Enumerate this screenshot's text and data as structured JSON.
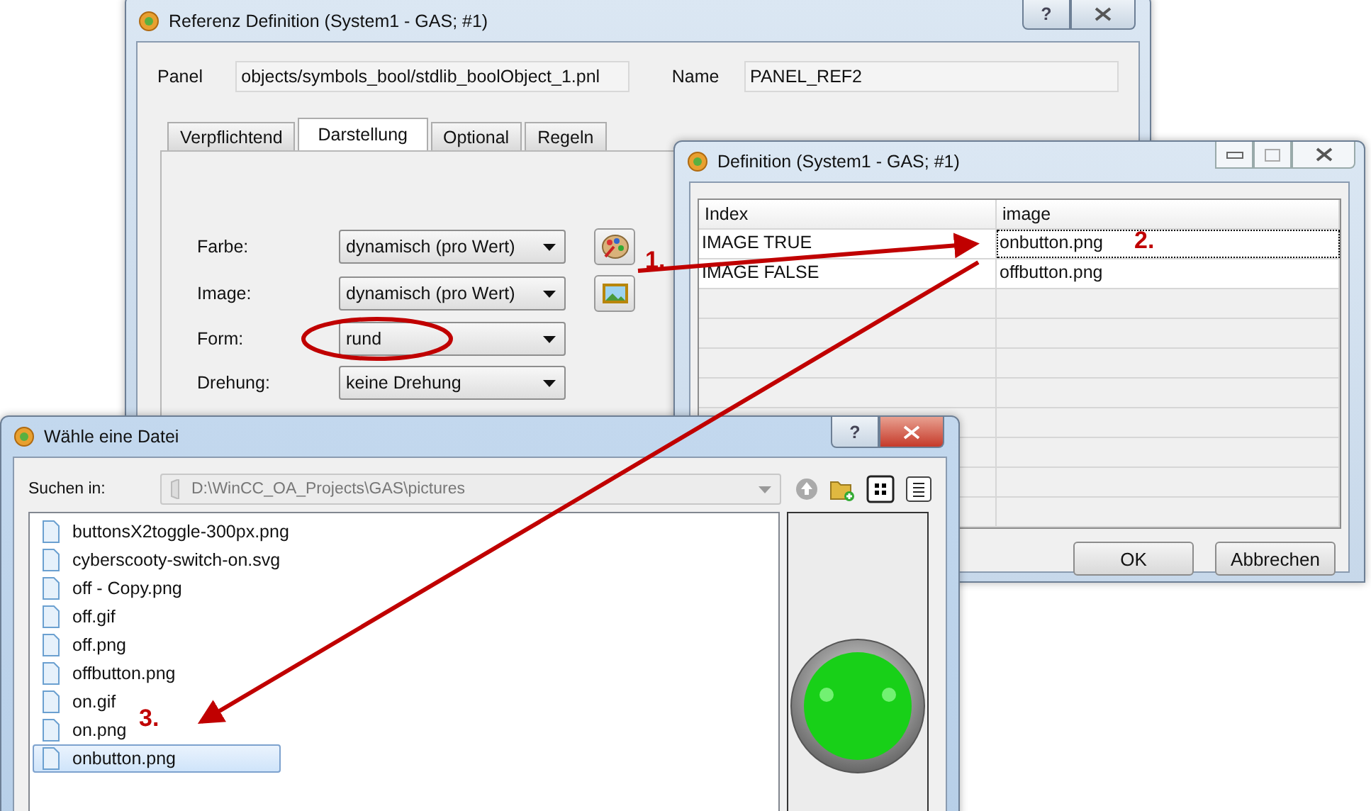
{
  "main_window": {
    "title": "Referenz Definition (System1 - GAS; #1)",
    "help": "?",
    "panel_label": "Panel",
    "panel_value": "objects/symbols_bool/stdlib_boolObject_1.pnl",
    "name_label": "Name",
    "name_value": "PANEL_REF2",
    "tabs": [
      {
        "label": "Verpflichtend",
        "selected": false
      },
      {
        "label": "Darstellung",
        "selected": true
      },
      {
        "label": "Optional",
        "selected": false
      },
      {
        "label": "Regeln",
        "selected": false
      }
    ],
    "rows": [
      {
        "label": "Farbe:",
        "value": "dynamisch (pro Wert)",
        "kind": "color-picker"
      },
      {
        "label": "Image:",
        "value": "dynamisch (pro Wert)",
        "kind": "image-picker"
      },
      {
        "label": "Form:",
        "value": "rund",
        "kind": "plain"
      },
      {
        "label": "Drehung:",
        "value": "keine Drehung",
        "kind": "plain"
      }
    ]
  },
  "definition_window": {
    "title": "Definition (System1 - GAS; #1)",
    "columns": [
      "Index",
      "image"
    ],
    "rows": [
      {
        "index": "IMAGE TRUE",
        "image": "onbutton.png",
        "selected": true
      },
      {
        "index": "IMAGE FALSE",
        "image": "offbutton.png",
        "selected": false
      }
    ],
    "buttons": [
      "OK",
      "Abbrechen"
    ]
  },
  "file_dialog": {
    "title": "Wähle eine Datei",
    "help": "?",
    "look_in_label": "Suchen in:",
    "path": "D:\\WinCC_OA_Projects\\GAS\\pictures",
    "files": [
      {
        "name": "buttonsX2toggle-300px.png",
        "selected": false
      },
      {
        "name": "cyberscooty-switch-on.svg",
        "selected": false
      },
      {
        "name": "off - Copy.png",
        "selected": false
      },
      {
        "name": "off.gif",
        "selected": false
      },
      {
        "name": "off.png",
        "selected": false
      },
      {
        "name": "offbutton.png",
        "selected": false
      },
      {
        "name": "on.gif",
        "selected": false
      },
      {
        "name": "on.png",
        "selected": false
      },
      {
        "name": "onbutton.png",
        "selected": true
      }
    ]
  },
  "steps": [
    {
      "label": "1."
    },
    {
      "label": "2."
    },
    {
      "label": "3."
    }
  ]
}
